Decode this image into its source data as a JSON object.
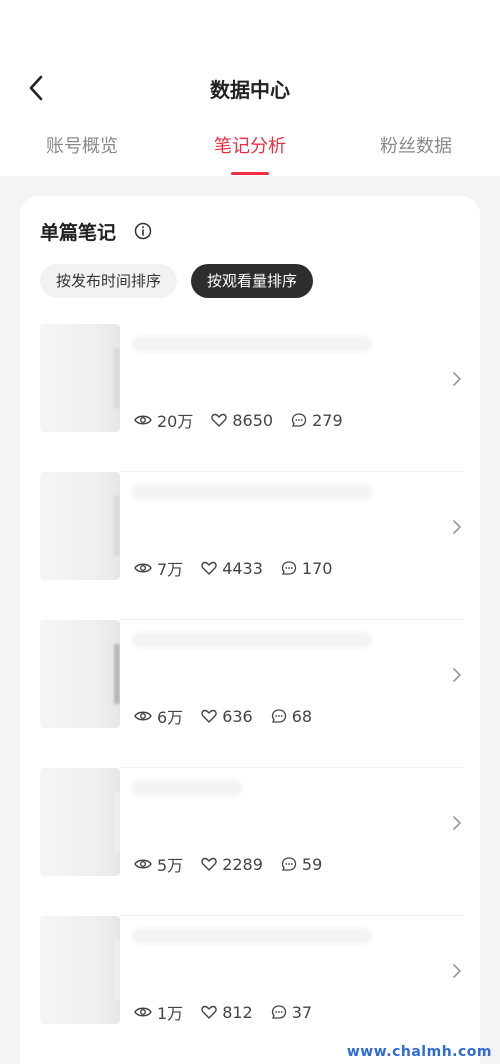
{
  "header": {
    "title": "数据中心"
  },
  "tabs": [
    {
      "label": "账号概览"
    },
    {
      "label": "笔记分析"
    },
    {
      "label": "粉丝数据"
    }
  ],
  "section": {
    "title": "单篇笔记",
    "sort_options": [
      {
        "label": "按发布时间排序",
        "selected": false
      },
      {
        "label": "按观看量排序",
        "selected": true
      }
    ]
  },
  "notes": [
    {
      "views": "20万",
      "likes": "8650",
      "comments": "279"
    },
    {
      "views": "7万",
      "likes": "4433",
      "comments": "170"
    },
    {
      "views": "6万",
      "likes": "636",
      "comments": "68"
    },
    {
      "views": "5万",
      "likes": "2289",
      "comments": "59"
    },
    {
      "views": "1万",
      "likes": "812",
      "comments": "37"
    }
  ],
  "icons": {
    "back": "chevron-left-icon",
    "info": "info-icon",
    "views": "eye-icon",
    "likes": "heart-icon",
    "comments": "comment-icon",
    "row": "chevron-right-icon"
  },
  "colors": {
    "accent": "#ee2f43",
    "dark_chip": "#2d2d2d",
    "background": "#f4f4f4"
  },
  "watermark": "www.chalmh.com"
}
